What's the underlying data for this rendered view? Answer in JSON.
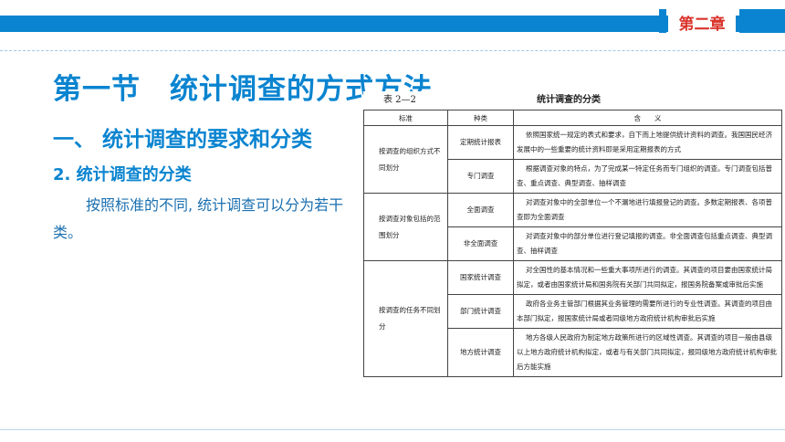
{
  "header": {
    "chapter": "第二章"
  },
  "section_title": "第一节　统计调查的方式方法",
  "subtitle": "一、 统计调查的要求和分类",
  "subtitle2": "2. 统计调查的分类",
  "body_text": "按照标准的不同, 统计调查可以分为若干类。",
  "table": {
    "number": "表 2—2",
    "caption": "统计调查的分类",
    "headers": [
      "标准",
      "种类",
      "含　　义"
    ],
    "groups": [
      {
        "standard": "按调查的组织方式不同划分",
        "rows": [
          {
            "type": "定期统计报表",
            "desc": "依照国家统一规定的表式和要求，自下而上地提供统计资料的调查。我国国民经济发展中的一些重要的统计资料即是采用定期报表的方式"
          },
          {
            "type": "专门调查",
            "desc": "根据调查对象的特点，为了完成某一特定任务而专门组织的调查。专门调查包括普查、重点调查、典型调查、抽样调查"
          }
        ]
      },
      {
        "standard": "按调查对象包括的范围划分",
        "rows": [
          {
            "type": "全面调查",
            "desc": "对调查对象中的全部单位一个不漏地进行填报登记的调查。多数定期报表、各项普查即为全面调查"
          },
          {
            "type": "非全面调查",
            "desc": "对调查对象中的部分单位进行登记填报的调查。非全面调查包括重点调查、典型调查、抽样调查"
          }
        ]
      },
      {
        "standard": "按调查的任务不同划分",
        "rows": [
          {
            "type": "国家统计调查",
            "desc": "对全国性的基本情况和一些重大事项所进行的调查。其调查的项目要由国家统计局拟定，或者由国家统计局和国务院有关部门共同拟定，报国务院备案或审批后实施"
          },
          {
            "type": "部门统计调查",
            "desc": "政府各业务主管部门根据其业务管理的需要所进行的专业性调查。其调查的项目由本部门拟定，报国家统计局或者同级地方政府统计机构审批后实施"
          },
          {
            "type": "地方统计调查",
            "desc": "地方各级人民政府为制定地方政策所进行的区域性调查。其调查的项目一般由县级以上地方政府统计机构拟定，或者与有关部门共同拟定，报同级地方政府统计机构审批后方能实施"
          }
        ]
      }
    ]
  }
}
